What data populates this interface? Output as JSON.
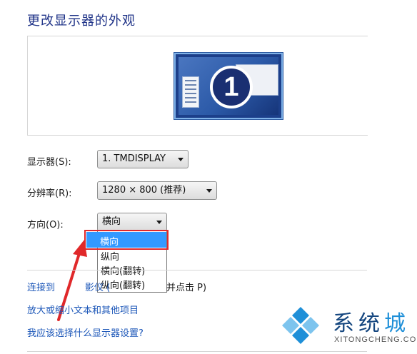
{
  "page": {
    "title": "更改显示器的外观"
  },
  "preview": {
    "monitor_number": "1"
  },
  "settings": {
    "display": {
      "label": "显示器(S):",
      "value": "1. TMDISPLAY"
    },
    "resolution": {
      "label": "分辨率(R):",
      "value": "1280 × 800 (推荐)"
    },
    "orientation": {
      "label": "方向(O):",
      "value": "横向",
      "options": [
        "横向",
        "纵向",
        "横向(翻转)",
        "纵向(翻转)"
      ],
      "highlighted": "横向"
    }
  },
  "links": {
    "projector_a": "连接到",
    "projector_b": "影仪 (",
    "projector_tail": "并点击 P)",
    "text_size": "放大或缩小文本和其他项目",
    "help": "我应该选择什么显示器设置?"
  },
  "watermark": {
    "brand_a": "系统",
    "brand_b": "城",
    "url": "XITONGCHENG.COM"
  },
  "colors": {
    "title": "#1e3287",
    "link": "#1b56b8",
    "selection": "#3399ff",
    "highlight_border": "#e0282a"
  }
}
